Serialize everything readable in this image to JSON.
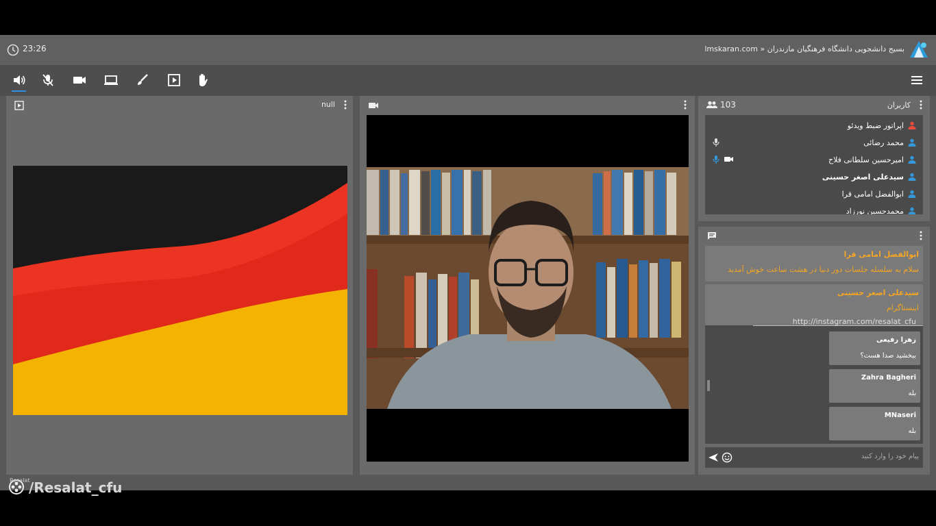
{
  "header": {
    "time": "23:26",
    "breadcrumb": "lmskaran.com » بسیج دانشجویی دانشگاه فرهنگیان مازندران"
  },
  "toolbar": {
    "items": [
      "speaker-icon",
      "mic-muted-icon",
      "camera-icon",
      "screen-share-icon",
      "brush-icon",
      "media-player-icon",
      "raise-hand-icon"
    ]
  },
  "left_panel": {
    "title": "null"
  },
  "users_panel": {
    "title": "کاربران",
    "count": "103",
    "users": [
      {
        "name": "اپراتور ضبط ویدئو",
        "bold": false,
        "mic": false,
        "cam": false,
        "color": "#e74c3c"
      },
      {
        "name": "محمد رضائی",
        "bold": false,
        "mic": true,
        "cam": false,
        "color": "#3498db"
      },
      {
        "name": "امیرحسین سلطانی فلاح",
        "bold": false,
        "mic": true,
        "cam": true,
        "color": "#3498db"
      },
      {
        "name": "سیدعلی اصغر حسینی",
        "bold": true,
        "mic": false,
        "cam": false,
        "color": "#3498db"
      },
      {
        "name": "ابوالفضل امامی قرا",
        "bold": false,
        "mic": false,
        "cam": false,
        "color": "#3498db"
      },
      {
        "name": "محمدحسین نورزاد",
        "bold": false,
        "mic": false,
        "cam": false,
        "color": "#3498db"
      }
    ]
  },
  "chat": {
    "messages": [
      {
        "sender": "ابوالفضل امامی قرا",
        "text": "سلام به سلسله جلسات دور دنیا در هشت ساعت خوش آمدید"
      },
      {
        "sender": "سیدعلی اصغر حسینی",
        "text": "اینستاگرام",
        "link": "http://instagram.com/resalat_cfu"
      }
    ],
    "replies": [
      {
        "sender": "زهرا رفیعی",
        "text": "ببخشید صدا هست؟"
      },
      {
        "sender": "Zahra Bagheri",
        "text": "بله"
      },
      {
        "sender": "MNaseri",
        "text": "بله"
      }
    ],
    "input_placeholder": "پیام خود را وارد کنید"
  },
  "watermark": "/Resalat_cfu",
  "watermark_small": "Resalat"
}
